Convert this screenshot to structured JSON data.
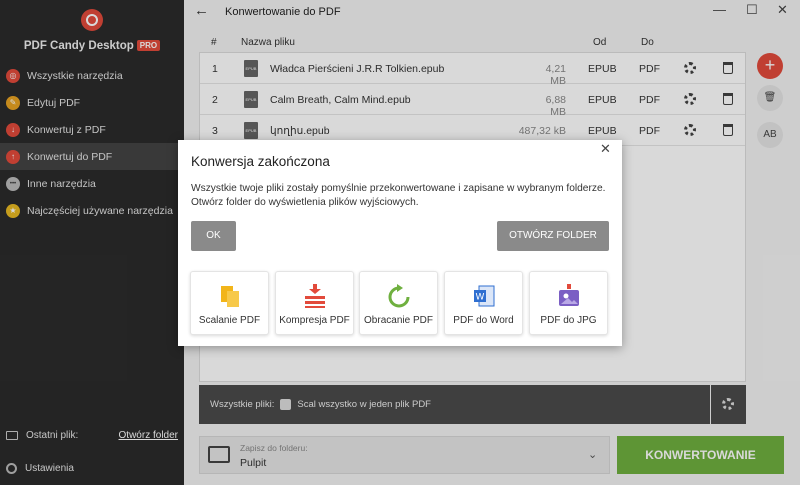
{
  "sidebar": {
    "brand": "PDF Candy Desktop",
    "badge": "PRO",
    "items": [
      {
        "label": "Wszystkie narzędzia",
        "icon": "target-icon",
        "color": "#e24a3b",
        "glyph": "◎"
      },
      {
        "label": "Edytuj PDF",
        "icon": "edit-icon",
        "color": "#e8a323",
        "glyph": "✎"
      },
      {
        "label": "Konwertuj z PDF",
        "icon": "convert-from-icon",
        "color": "#e24a3b",
        "glyph": "↓"
      },
      {
        "label": "Konwertuj do PDF",
        "icon": "convert-to-icon",
        "color": "#e24a3b",
        "glyph": "↑"
      },
      {
        "label": "Inne narzędzia",
        "icon": "more-icon",
        "color": "#bbbbbb",
        "glyph": "•••"
      },
      {
        "label": "Najczęściej używane narzędzia",
        "icon": "star-icon",
        "color": "#e8b923",
        "glyph": "★"
      }
    ],
    "recent_label": "Ostatni plik:",
    "open_folder": "Otwórz folder",
    "settings": "Ustawienia"
  },
  "header": {
    "back": "←",
    "title": "Konwertowanie do PDF",
    "minimize": "—",
    "maximize": "☐",
    "close": "✕"
  },
  "table": {
    "columns": {
      "num": "#",
      "name": "Nazwa pliku",
      "from": "Od",
      "to": "Do"
    },
    "rows": [
      {
        "num": "1",
        "name": "Władca Pierścieni J.R.R Tolkien.epub",
        "size": "4,21 MB",
        "from": "EPUB",
        "to": "PDF"
      },
      {
        "num": "2",
        "name": "Calm Breath, Calm Mind.epub",
        "size": "6,88 MB",
        "from": "EPUB",
        "to": "PDF"
      },
      {
        "num": "3",
        "name": "կողիս.epub",
        "size": "487,32 kB",
        "from": "EPUB",
        "to": "PDF"
      }
    ]
  },
  "tools": {
    "add": "+",
    "delete": "🗑",
    "rename": "AB"
  },
  "bottom": {
    "all_files": "Wszystkie pliki:",
    "merge_label": "Scal wszystko w jeden plik PDF",
    "save_label": "Zapisz do folderu:",
    "save_value": "Pulpit",
    "convert": "KONWERTOWANIE"
  },
  "dialog": {
    "title": "Konwersja zakończona",
    "close": "✕",
    "message": "Wszystkie twoje pliki zostały pomyślnie przekonwertowane i zapisane w wybranym folderze. Otwórz folder do wyświetlenia plików wyjściowych.",
    "ok": "OK",
    "open_folder": "OTWÓRZ FOLDER",
    "cards": [
      {
        "label": "Scalanie PDF",
        "icon": "merge-icon",
        "color": "#f2b51a"
      },
      {
        "label": "Kompresja PDF",
        "icon": "compress-icon",
        "color": "#e24a3b"
      },
      {
        "label": "Obracanie PDF",
        "icon": "rotate-icon",
        "color": "#6fb03f"
      },
      {
        "label": "PDF do Word",
        "icon": "word-icon",
        "color": "#2f6fd1"
      },
      {
        "label": "PDF do JPG",
        "icon": "image-icon",
        "color": "#7b5fc4"
      }
    ]
  }
}
